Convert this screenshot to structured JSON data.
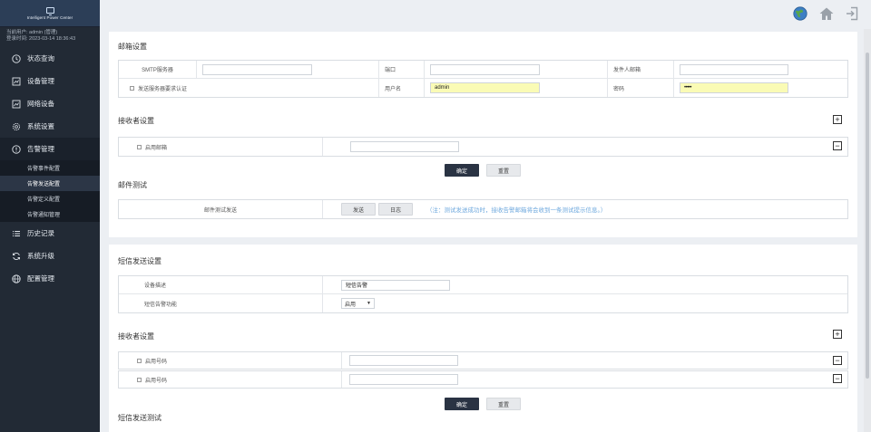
{
  "brand": {
    "name": "Intelligent Power Center"
  },
  "user": {
    "line1": "当前用户: admin (管理)",
    "line2": "登录时间: 2023-03-14 18:36:43"
  },
  "nav": [
    {
      "label": "状态查询",
      "icon": "clock-icon"
    },
    {
      "label": "设备管理",
      "icon": "device-icon"
    },
    {
      "label": "网络设备",
      "icon": "network-icon"
    },
    {
      "label": "系统设置",
      "icon": "gear-icon"
    },
    {
      "label": "告警管理",
      "icon": "alert-icon"
    },
    {
      "label": "历史记录",
      "icon": "list-icon"
    },
    {
      "label": "系统升级",
      "icon": "refresh-icon"
    },
    {
      "label": "配置管理",
      "icon": "globe-icon"
    }
  ],
  "subnav": [
    "告警事件配置",
    "告警发送配置",
    "告警定义配置",
    "告警通知管理"
  ],
  "email": {
    "title": "邮箱设置",
    "smtp_label": "SMTP服务器",
    "smtp_value": "",
    "port_label": "端口",
    "port_value": "",
    "sender_label": "发件人邮箱",
    "sender_value": "",
    "auth_label": "发送服务器要求认证",
    "username_label": "用户名",
    "username_value": "admin",
    "password_label": "密码",
    "password_value": "•••••"
  },
  "recipient_email": {
    "title": "接收者设置",
    "enable_label": "启用邮箱",
    "value": ""
  },
  "buttons": {
    "confirm": "确定",
    "reset": "重置",
    "send": "发送",
    "log": "日志"
  },
  "mail_test": {
    "title": "邮件测试",
    "label": "邮件测试发送",
    "note": "（注：测试发送成功时，接收告警邮箱将会收到一条测试提示信息。）"
  },
  "sms": {
    "title": "短信发送设置",
    "device_desc_label": "设备描述",
    "device_desc_value": "短信告警",
    "alarm_func_label": "短信告警功能",
    "alarm_func_value": "启用"
  },
  "recipient_sms": {
    "title": "接收者设置",
    "rows": [
      {
        "label": "启用号码",
        "value": ""
      },
      {
        "label": "启用号码",
        "value": ""
      }
    ]
  },
  "sms_test": {
    "title": "短信发送测试"
  }
}
